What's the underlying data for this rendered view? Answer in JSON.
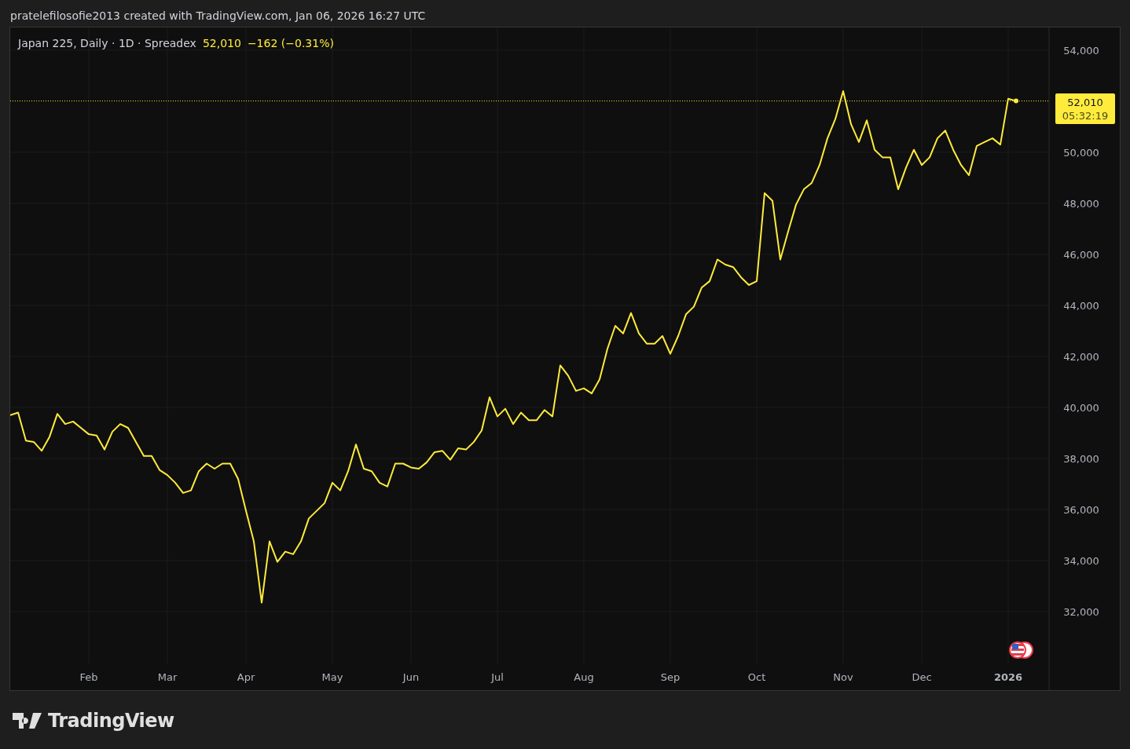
{
  "attribution": "pratelefilosofie2013 created with TradingView.com, Jan 06, 2026 16:27 UTC",
  "legend": {
    "symbol": "Japan 225, Daily · 1D · Spreadex",
    "price": "52,010",
    "change": "−162 (−0.31%)"
  },
  "price_label": {
    "price": "52,010",
    "countdown": "05:32:19"
  },
  "chart_data": {
    "type": "line",
    "grid": true,
    "ref_lines": [
      {
        "axis": "y",
        "value": 52010
      }
    ],
    "ylim": [
      29970,
      54890
    ],
    "categories": [
      null,
      null,
      null,
      null,
      null,
      null,
      null,
      null,
      null,
      null,
      "Feb",
      null,
      null,
      null,
      null,
      null,
      null,
      null,
      null,
      null,
      "Mar",
      null,
      null,
      null,
      null,
      null,
      null,
      null,
      null,
      null,
      "Apr",
      null,
      null,
      null,
      null,
      null,
      null,
      null,
      null,
      null,
      null,
      "May",
      null,
      null,
      null,
      null,
      null,
      null,
      null,
      null,
      null,
      "Jun",
      null,
      null,
      null,
      null,
      null,
      null,
      null,
      null,
      null,
      null,
      "Jul",
      null,
      null,
      null,
      null,
      null,
      null,
      null,
      null,
      null,
      null,
      "Aug",
      null,
      null,
      null,
      null,
      null,
      null,
      null,
      null,
      null,
      null,
      "Sep",
      null,
      null,
      null,
      null,
      null,
      null,
      null,
      null,
      null,
      null,
      "Oct",
      null,
      null,
      null,
      null,
      null,
      null,
      null,
      null,
      null,
      null,
      "Nov",
      null,
      null,
      null,
      null,
      null,
      null,
      null,
      null,
      null,
      "Dec",
      null,
      null,
      null,
      null,
      null,
      null,
      null,
      null,
      null,
      null,
      "2026",
      null
    ],
    "series": [
      {
        "color": "#ffeb3b",
        "values": [
          39700,
          39800,
          38700,
          38650,
          38300,
          38850,
          39750,
          39350,
          39450,
          39200,
          38950,
          38900,
          38350,
          39050,
          39350,
          39200,
          38650,
          38100,
          38100,
          37550,
          37350,
          37050,
          36650,
          36750,
          37500,
          37800,
          37600,
          37800,
          37800,
          37200,
          35950,
          34750,
          32350,
          34750,
          33950,
          34350,
          34250,
          34750,
          35650,
          35950,
          36250,
          37050,
          36750,
          37500,
          38550,
          37600,
          37500,
          37050,
          36900,
          37800,
          37800,
          37650,
          37600,
          37850,
          38250,
          38300,
          37950,
          38400,
          38350,
          38650,
          39100,
          40400,
          39650,
          39950,
          39350,
          39800,
          39500,
          39500,
          39900,
          39650,
          41650,
          41250,
          40650,
          40750,
          40550,
          41100,
          42300,
          43200,
          42900,
          43700,
          42900,
          42500,
          42500,
          42800,
          42100,
          42800,
          43650,
          43950,
          44700,
          44950,
          45800,
          45600,
          45500,
          45100,
          44800,
          44950,
          48400,
          48100,
          45800,
          46900,
          47950,
          48550,
          48800,
          49500,
          50550,
          51300,
          52400,
          51100,
          50400,
          51250,
          50100,
          49800,
          49800,
          48550,
          49400,
          50100,
          49500,
          49800,
          50550,
          50850,
          50100,
          49500,
          49100,
          50250,
          50400,
          50550,
          50300,
          52100,
          52010
        ]
      }
    ],
    "yticks": [
      {
        "value": 32000,
        "label": "32,000"
      },
      {
        "value": 34000,
        "label": "34,000"
      },
      {
        "value": 36000,
        "label": "36,000"
      },
      {
        "value": 38000,
        "label": "38,000"
      },
      {
        "value": 40000,
        "label": "40,000"
      },
      {
        "value": 42000,
        "label": "42,000"
      },
      {
        "value": 44000,
        "label": "44,000"
      },
      {
        "value": 46000,
        "label": "46,000"
      },
      {
        "value": 48000,
        "label": "48,000"
      },
      {
        "value": 50000,
        "label": "50,000"
      },
      {
        "value": 54000,
        "label": "54,000"
      }
    ]
  },
  "brand": {
    "name": "TradingView"
  }
}
